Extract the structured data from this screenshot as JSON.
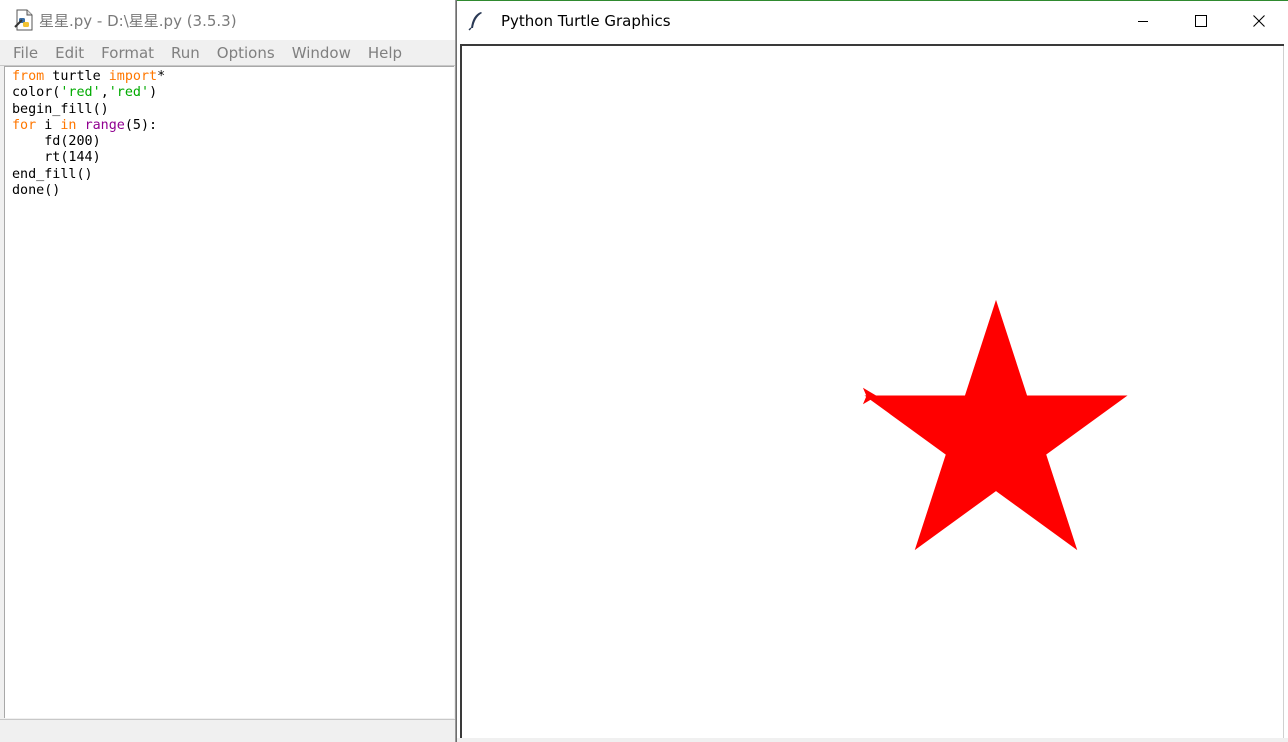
{
  "idle": {
    "title": "星星.py - D:\\星星.py (3.5.3)",
    "app_icon": "python-file-icon",
    "menu": [
      "File",
      "Edit",
      "Format",
      "Run",
      "Options",
      "Window",
      "Help"
    ],
    "code": {
      "line1": {
        "kw1": "from",
        "mid": " turtle ",
        "kw2": "import",
        "end": "*"
      },
      "line2": {
        "pre": "color(",
        "s1": "'red'",
        "comma": ",",
        "s2": "'red'",
        "post": ")"
      },
      "line3": "begin_fill()",
      "line4": {
        "kw1": "for",
        "mid1": " i ",
        "kw2": "in",
        "sp": " ",
        "bi": "range",
        "post": "(5):"
      },
      "line5": "    fd(200)",
      "line6": "    rt(144)",
      "line7": "end_fill()",
      "line8": "done()"
    },
    "colors": {
      "keyword": "#ff7700",
      "builtin": "#900090",
      "string": "#00aa00"
    }
  },
  "turtle": {
    "title": "Python Turtle Graphics",
    "icon": "feather-icon",
    "controls": [
      "minimize-icon",
      "maximize-icon",
      "close-icon"
    ],
    "drawing": {
      "fill_color": "#ff0000",
      "pen_color": "#ff0000",
      "side_length": 200,
      "turn_angle": 144,
      "repeats": 5
    }
  }
}
